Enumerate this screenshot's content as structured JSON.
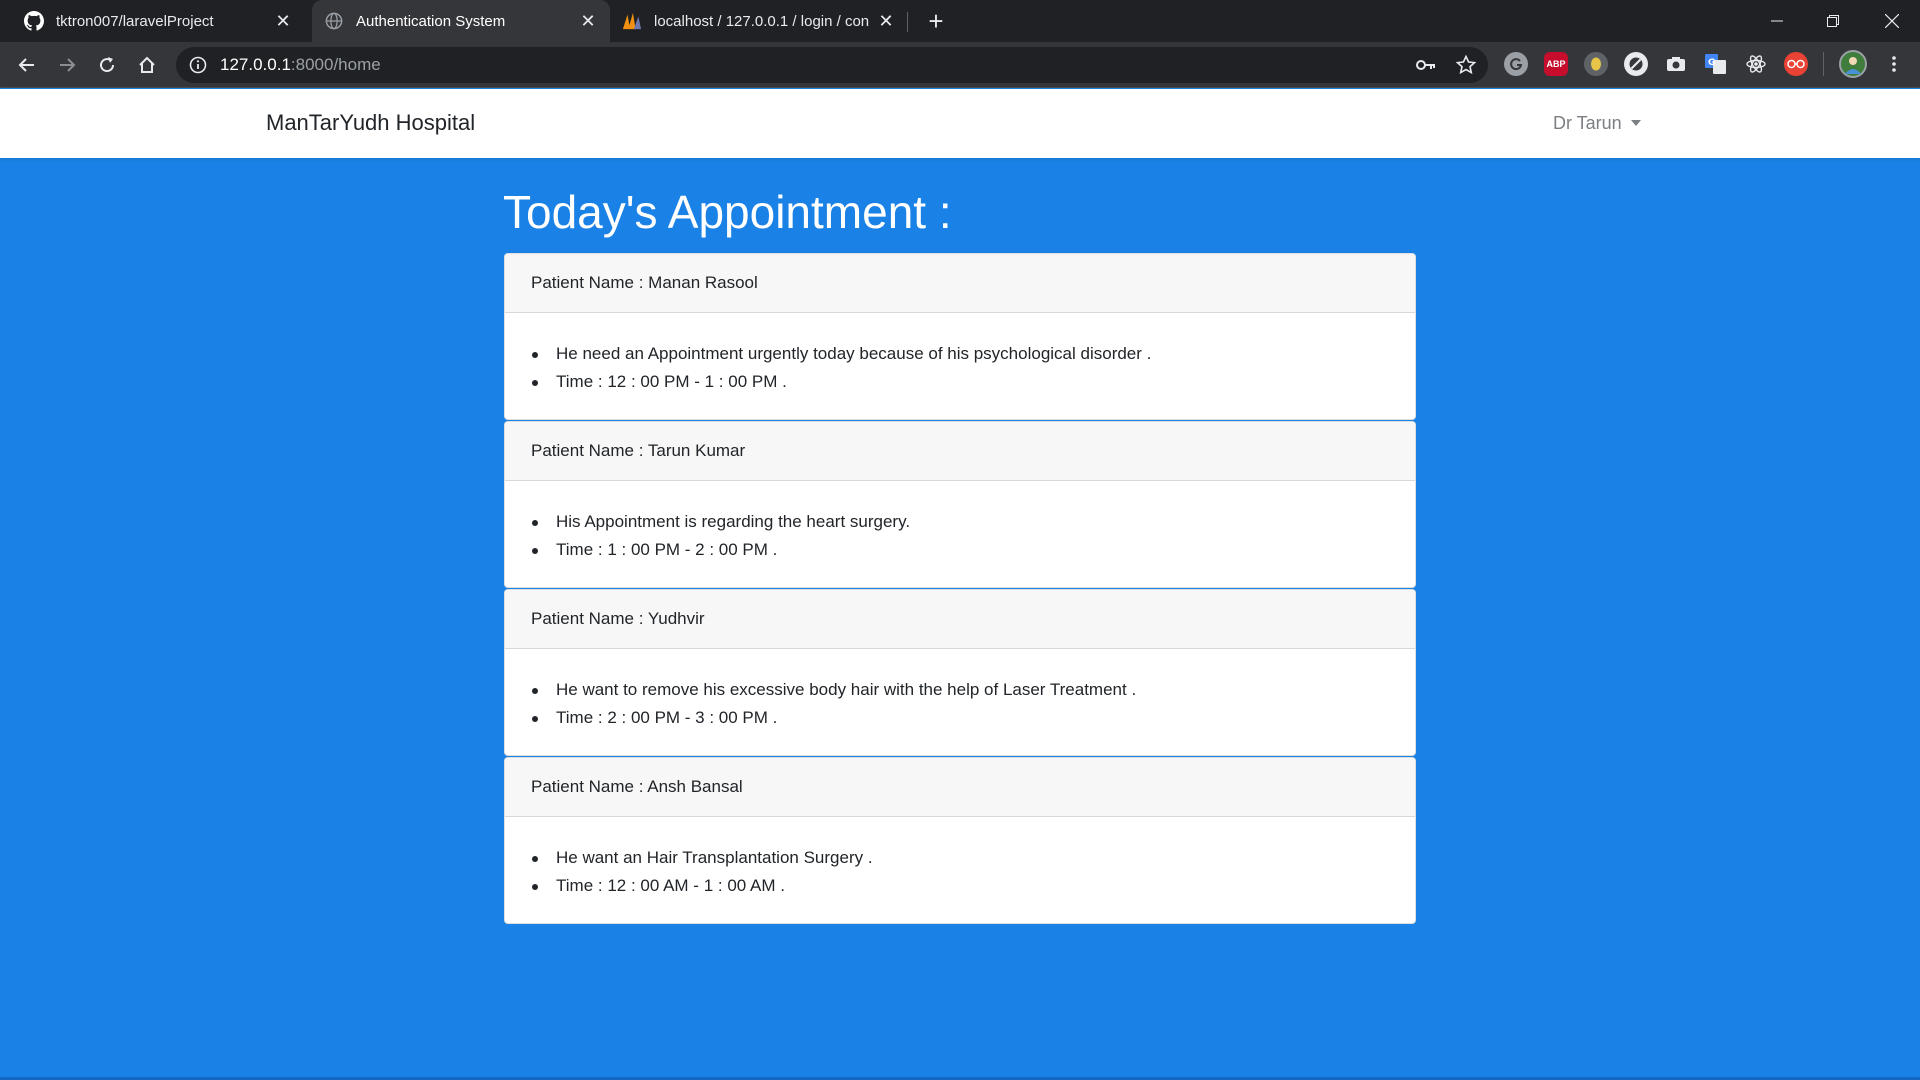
{
  "browser": {
    "tabs": [
      {
        "title": "tktron007/laravelProject",
        "favicon": "github-icon",
        "active": false
      },
      {
        "title": "Authentication System",
        "favicon": "globe-icon",
        "active": true
      },
      {
        "title": "localhost / 127.0.0.1 / login / con",
        "favicon": "phpmyadmin-icon",
        "active": false
      }
    ],
    "url_host": "127.0.0.1",
    "url_path": ":8000/home",
    "extensions": [
      {
        "name": "grammarly-icon",
        "color": "#5f6368"
      },
      {
        "name": "adblock-plus-icon",
        "label": "ABP",
        "color": "#c70d2c"
      },
      {
        "name": "honey-icon",
        "color": "#e8c547"
      },
      {
        "name": "block-icon",
        "color": "#5f6368"
      },
      {
        "name": "camera-icon",
        "color": "#5f6368"
      },
      {
        "name": "google-translate-icon",
        "color": "#4285f4"
      },
      {
        "name": "react-devtools-icon",
        "color": "#5f6368"
      },
      {
        "name": "spectacles-icon",
        "color": "#ea4335"
      }
    ]
  },
  "navbar": {
    "brand": "ManTarYudh Hospital",
    "user": "Dr Tarun"
  },
  "main": {
    "title": "Today's Appointment :",
    "appointments": [
      {
        "patient": "Patient Name : Manan Rasool",
        "details": [
          "He need an Appointment urgently today because of his psychological disorder .",
          "Time : 12 : 00 PM - 1 : 00 PM ."
        ]
      },
      {
        "patient": "Patient Name : Tarun Kumar",
        "details": [
          "His Appointment is regarding the heart surgery.",
          "Time : 1 : 00 PM - 2 : 00 PM ."
        ]
      },
      {
        "patient": "Patient Name : Yudhvir",
        "details": [
          "He want to remove his excessive body hair with the help of Laser Treatment .",
          "Time : 2 : 00 PM - 3 : 00 PM ."
        ]
      },
      {
        "patient": "Patient Name : Ansh Bansal",
        "details": [
          "He want an Hair Transplantation Surgery .",
          "Time : 12 : 00 AM - 1 : 00 AM ."
        ]
      }
    ]
  },
  "colors": {
    "page_background": "#1a82e6",
    "navbar_background": "#ffffff",
    "card_header_background": "#f7f7f7"
  }
}
